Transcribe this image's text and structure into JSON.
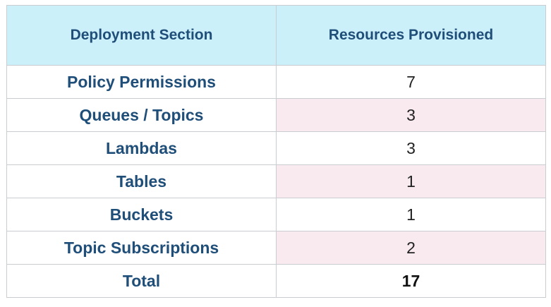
{
  "table": {
    "headers": {
      "section": "Deployment Section",
      "resources": "Resources Provisioned"
    },
    "rows": [
      {
        "section": "Policy Permissions",
        "resources": "7"
      },
      {
        "section": "Queues / Topics",
        "resources": "3"
      },
      {
        "section": "Lambdas",
        "resources": "3"
      },
      {
        "section": "Tables",
        "resources": "1"
      },
      {
        "section": "Buckets",
        "resources": "1"
      },
      {
        "section": "Topic Subscriptions",
        "resources": "2"
      }
    ],
    "total": {
      "section": "Total",
      "resources": "17"
    }
  },
  "colors": {
    "header_bg": "#ccf0fa",
    "header_text": "#1f4e79",
    "alt_row_bg": "#f8eaef",
    "border": "#c9ccd1"
  }
}
